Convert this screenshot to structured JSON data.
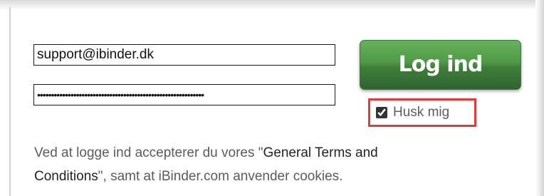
{
  "login": {
    "email_value": "support@ibinder.dk",
    "password_value": "••••••••••••••••••••••••••••••••••••••••••••••••••••••••••••",
    "button_label": "Log ind",
    "remember_label": "Husk mig",
    "remember_checked": true
  },
  "terms": {
    "prefix": "Ved at logge ind accepterer du vores \"",
    "link_part1": "General Terms and",
    "link_part2": "Conditions",
    "suffix": "\", samt at iBinder.com anvender cookies."
  },
  "colors": {
    "button_green": "#4f9a46",
    "highlight_red": "#e23a3a"
  }
}
